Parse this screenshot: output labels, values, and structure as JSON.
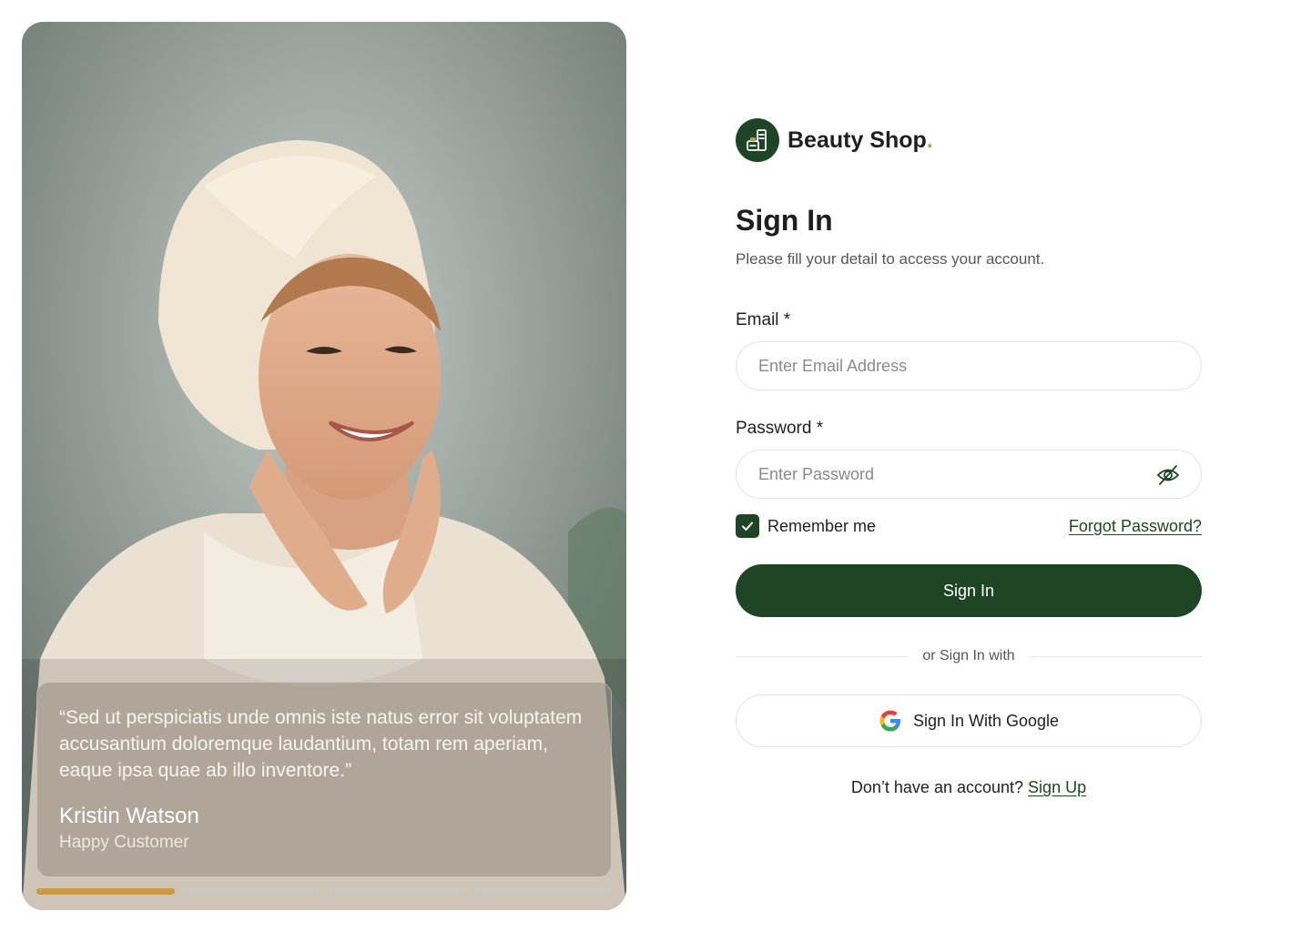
{
  "brand": {
    "name": "Beauty Shop",
    "dot": ".",
    "logo_icon": "beauty-products-icon",
    "accent": "#c99a45",
    "primary": "#1f4527"
  },
  "form": {
    "title": "Sign In",
    "subtitle": "Please fill your detail to access your account.",
    "email_label": "Email *",
    "email_placeholder": "Enter Email Address",
    "email_value": "",
    "password_label": "Password *",
    "password_placeholder": "Enter Password",
    "password_value": "",
    "password_toggle_icon": "eye-off-icon",
    "remember_label": "Remember me",
    "remember_checked": true,
    "forgot_label": "Forgot Password?",
    "submit_label": "Sign In",
    "divider_label": "or Sign In with",
    "google_label": "Sign In With Google",
    "signup_prompt": "Don’t have an account?",
    "signup_link": "Sign Up"
  },
  "testimonial": {
    "quote": "“Sed ut perspiciatis unde omnis iste natus error sit voluptatem accusantium doloremque laudantium, totam rem aperiam, eaque ipsa quae ab illo inventore.”",
    "name": "Kristin Watson",
    "role": "Happy Customer",
    "slides_total": 4,
    "active_slide": 1
  }
}
